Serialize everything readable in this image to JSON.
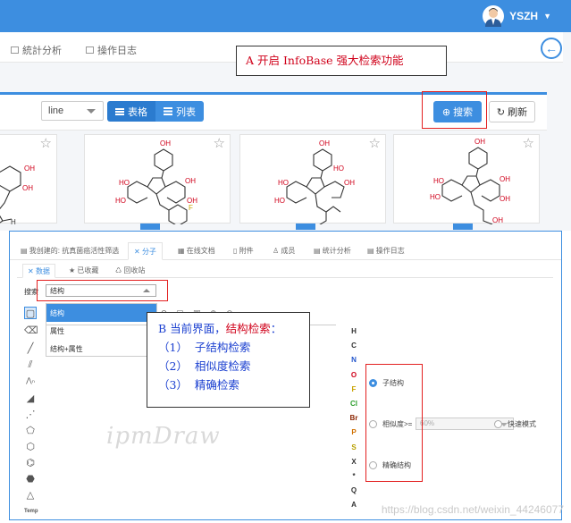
{
  "top": {
    "user": "YSZH",
    "tabs": [
      "統計分析",
      "操作日志"
    ],
    "callout_a": "A 开启 InfoBase 强大检索功能",
    "view_select": "line",
    "btn_table": "表格",
    "btn_list": "列表",
    "btn_search": "搜索",
    "btn_refresh": "刷新"
  },
  "bottom": {
    "tabs": [
      "我创建的: 抗真菌癌活性筛选",
      "分子",
      "在线文档",
      "附件",
      "成员",
      "统计分析",
      "操作日志"
    ],
    "subtabs": [
      "数据",
      "已收藏",
      "回收站"
    ],
    "search_label": "搜索",
    "search_value": "结构",
    "dropdown_items": [
      "结构",
      "属性",
      "结构+属性"
    ],
    "elements": [
      "H",
      "C",
      "N",
      "O",
      "F",
      "Cl",
      "Br",
      "P",
      "S",
      "X",
      "*",
      "Q",
      "A"
    ],
    "element_colors": [
      "#333333",
      "#333333",
      "#2255cc",
      "#d0021b",
      "#c8a200",
      "#2a9d2a",
      "#8b2500",
      "#d07000",
      "#b8a000",
      "#333333",
      "#333333",
      "#333333",
      "#333333"
    ],
    "opt_substructure": "子结构",
    "opt_similarity": "相似度>=",
    "similarity_value": "60%",
    "opt_fast": "快速模式",
    "opt_exact": "精确结构",
    "watermark": "ipmDraw",
    "tool_text": "Temp",
    "tool_t": "T"
  },
  "callout_b": {
    "title_prefix": "B 当前界面，",
    "title_highlight": "结构检索",
    "title_suffix": "：",
    "items": [
      {
        "num": "（1）",
        "text": "子结构检索"
      },
      {
        "num": "（2）",
        "text": "相似度检索"
      },
      {
        "num": "（3）",
        "text": "精确检索"
      }
    ]
  },
  "watermark_url": "https://blog.csdn.net/weixin_44246077",
  "accent": "#3d8ee0",
  "highlight_red": "#e32020"
}
